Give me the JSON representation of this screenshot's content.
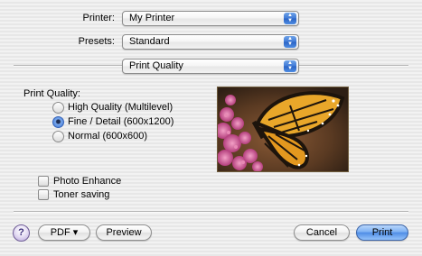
{
  "printer": {
    "label": "Printer:",
    "value": "My Printer"
  },
  "presets": {
    "label": "Presets:",
    "value": "Standard"
  },
  "panel": {
    "value": "Print Quality"
  },
  "print_quality": {
    "heading": "Print Quality:",
    "options": [
      {
        "label": "High Quality (Multilevel)",
        "selected": false
      },
      {
        "label": "Fine / Detail (600x1200)",
        "selected": true
      },
      {
        "label": "Normal (600x600)",
        "selected": false
      }
    ]
  },
  "checkboxes": [
    {
      "label": "Photo Enhance",
      "checked": false
    },
    {
      "label": "Toner saving",
      "checked": false
    }
  ],
  "footer": {
    "help_label": "?",
    "pdf_label": "PDF ▾",
    "preview_label": "Preview",
    "cancel_label": "Cancel",
    "print_label": "Print"
  },
  "colors": {
    "accent": "#4f8de6",
    "background": "#ececec"
  }
}
